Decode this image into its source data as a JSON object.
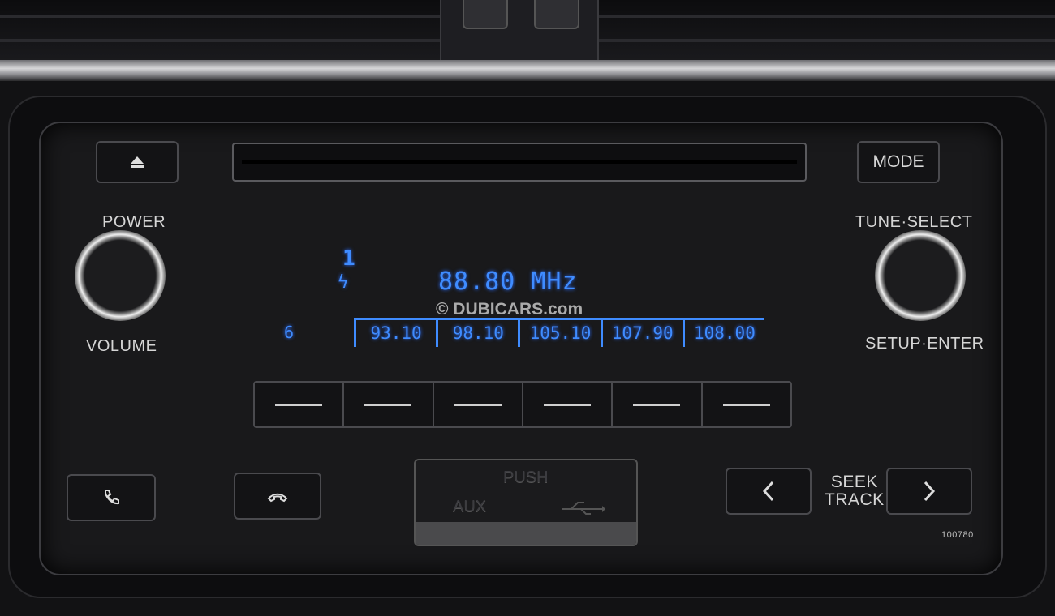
{
  "radio": {
    "eject_icon": "eject-icon",
    "mode_label": "MODE",
    "power_label": "POWER",
    "volume_label": "VOLUME",
    "tune_select_label": "TUNE·SELECT",
    "setup_enter_label": "SETUP·ENTER",
    "seek_label_1": "SEEK",
    "seek_label_2": "TRACK",
    "serial": "100780",
    "cover": {
      "push_label": "PUSH",
      "aux_label": "AUX",
      "usb_icon": "usb-icon"
    },
    "phone_pickup_icon": "phone-icon",
    "phone_hangup_icon": "phone-hangup-icon"
  },
  "display": {
    "band_indicator": "1",
    "frequency": "88.80 MHz",
    "preset_page": "6",
    "presets": [
      "93.10",
      "98.10",
      "105.10",
      "107.90",
      "108.00"
    ],
    "color": "#3f8cff"
  },
  "watermark": "© DUBICARS.com"
}
